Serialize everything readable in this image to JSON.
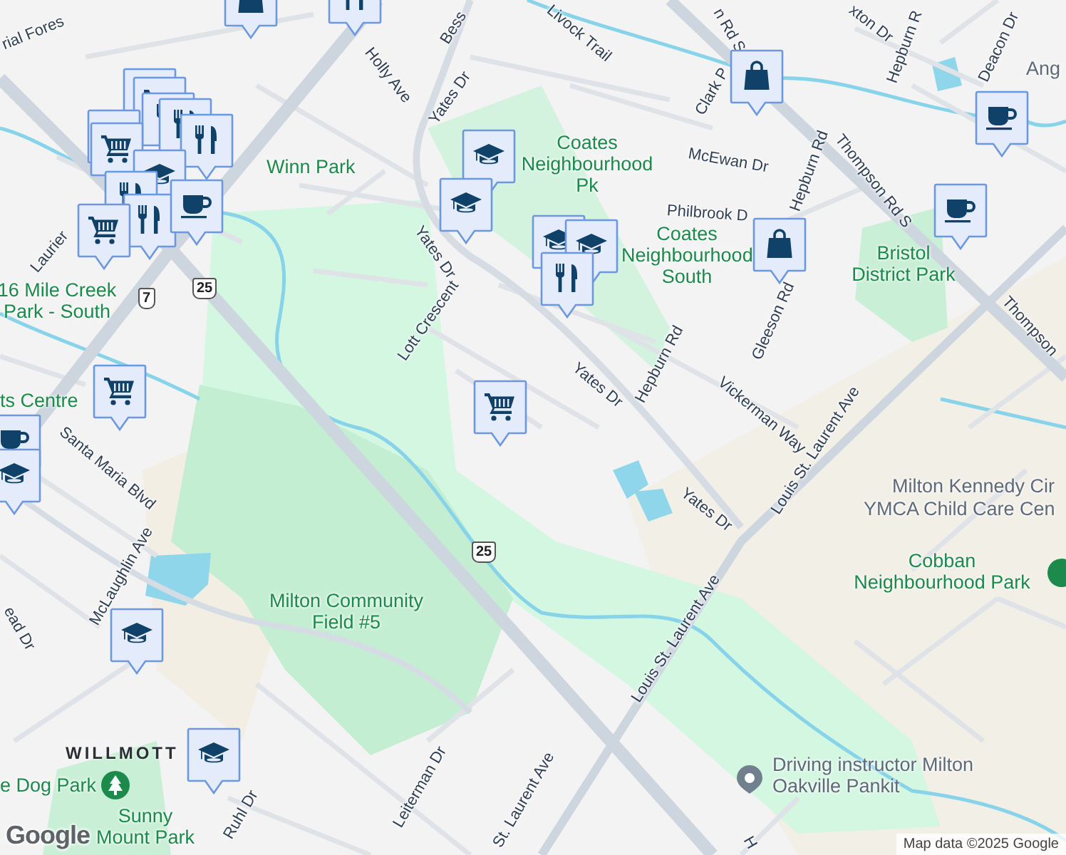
{
  "map": {
    "labels": [
      {
        "text": "rial Fores",
        "kind": "street"
      },
      {
        "text": "Bess",
        "kind": "street"
      },
      {
        "text": "Holly Ave",
        "kind": "street"
      },
      {
        "text": "Yates Dr",
        "kind": "street"
      },
      {
        "text": "Livock Trail",
        "kind": "street"
      },
      {
        "text": "n Rd S",
        "kind": "street"
      },
      {
        "text": "xton Dr",
        "kind": "street"
      },
      {
        "text": "Hepburn R",
        "kind": "street"
      },
      {
        "text": "Deacon Dr",
        "kind": "street"
      },
      {
        "text": "Clark P",
        "kind": "street"
      },
      {
        "text": "McEwan Dr",
        "kind": "street"
      },
      {
        "text": "Hepburn Rd",
        "kind": "street"
      },
      {
        "text": "Thompson Rd S",
        "kind": "street"
      },
      {
        "text": "Philbrook D",
        "kind": "street"
      },
      {
        "text": "Yates Dr",
        "kind": "street"
      },
      {
        "text": "Laurier",
        "kind": "street"
      },
      {
        "text": "Lott Crescent",
        "kind": "street"
      },
      {
        "text": "Hepburn Rd",
        "kind": "street"
      },
      {
        "text": "Gleeson Rd",
        "kind": "street"
      },
      {
        "text": "Vickerman Way",
        "kind": "street"
      },
      {
        "text": "Yates Dr",
        "kind": "street"
      },
      {
        "text": "Thompson",
        "kind": "street"
      },
      {
        "text": "Louis St. Laurent Ave",
        "kind": "street"
      },
      {
        "text": "Yates Dr",
        "kind": "street"
      },
      {
        "text": "Louis St. Laurent Ave",
        "kind": "street"
      },
      {
        "text": "Santa Maria Blvd",
        "kind": "street"
      },
      {
        "text": "McLaughlin Ave",
        "kind": "street"
      },
      {
        "text": "ead Dr",
        "kind": "street"
      },
      {
        "text": "Leiterman Dr",
        "kind": "street"
      },
      {
        "text": "Ruhl Dr",
        "kind": "street"
      },
      {
        "text": "St. Laurent Ave",
        "kind": "street"
      },
      {
        "text": "H",
        "kind": "street"
      },
      {
        "text": "Winn Park",
        "kind": "park"
      },
      {
        "text": "Coates Neighbourhood Pk",
        "kind": "park"
      },
      {
        "text": "Coates Neighbourhood South",
        "kind": "park"
      },
      {
        "text": "Bristol District Park",
        "kind": "park"
      },
      {
        "text": "16 Mile Creek Park - South",
        "kind": "park"
      },
      {
        "text": "ts Centre",
        "kind": "park"
      },
      {
        "text": "Milton Community Field #5",
        "kind": "park"
      },
      {
        "text": "Cobban Neighbourhood Park",
        "kind": "park"
      },
      {
        "text": "e Dog Park",
        "kind": "park"
      },
      {
        "text": "Sunny Mount Park",
        "kind": "park"
      },
      {
        "text": "Ang",
        "kind": "place"
      },
      {
        "text": "Milton Kennedy Cir",
        "kind": "place"
      },
      {
        "text": "YMCA Child Care Cen",
        "kind": "place"
      },
      {
        "text": "Driving instructor Milton Oakville Pankit",
        "kind": "place"
      },
      {
        "text": "WILLMOTT",
        "kind": "area"
      }
    ],
    "shields": [
      {
        "text": "7"
      },
      {
        "text": "25"
      },
      {
        "text": "25"
      }
    ],
    "pins": [
      {
        "kind": "bag"
      },
      {
        "kind": "restaurant"
      },
      {
        "kind": "cart"
      },
      {
        "kind": "cart"
      },
      {
        "kind": "restaurant"
      },
      {
        "kind": "restaurant"
      },
      {
        "kind": "restaurant"
      },
      {
        "kind": "cart"
      },
      {
        "kind": "cart"
      },
      {
        "kind": "school"
      },
      {
        "kind": "restaurant"
      },
      {
        "kind": "restaurant"
      },
      {
        "kind": "cafe"
      },
      {
        "kind": "cart"
      },
      {
        "kind": "school"
      },
      {
        "kind": "school"
      },
      {
        "kind": "cart"
      },
      {
        "kind": "cafe"
      },
      {
        "kind": "school"
      },
      {
        "kind": "cart"
      },
      {
        "kind": "school"
      },
      {
        "kind": "school"
      },
      {
        "kind": "restaurant"
      },
      {
        "kind": "bag"
      },
      {
        "kind": "bag"
      },
      {
        "kind": "cafe"
      },
      {
        "kind": "cafe"
      },
      {
        "kind": "school"
      },
      {
        "kind": "school"
      }
    ],
    "logo": "Google",
    "attribution": "Map data ©2025 Google"
  }
}
